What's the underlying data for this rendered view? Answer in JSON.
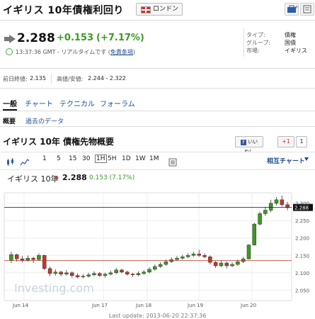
{
  "header": {
    "title": "イギリス 10年債権利回り",
    "region_button": "ロンドン"
  },
  "quote": {
    "price": "2.288",
    "change": "+0.153",
    "change_pct": "(+7.17%)",
    "time": "13:37:36 GMT - リアルタイムです",
    "disclaimer": "免責条項"
  },
  "info": {
    "type_label": "タイプ:",
    "type_value": "債権",
    "group_label": "グループ:",
    "group_value": "国債",
    "market_label": "市場:",
    "market_value": "イギリス"
  },
  "stats": {
    "prev_close_label": "前日終値:",
    "prev_close": "2.135",
    "range_label": "高値/安値:",
    "range": "2.244 - 2.322"
  },
  "tabs": [
    "一般",
    "チャート",
    "テクニカル",
    "フォーラム"
  ],
  "subtabs": [
    "概要",
    "過去のデータ"
  ],
  "section_title": "イギリス 10年 債権先物概要",
  "social": {
    "like": "いいね！",
    "gplus": "+1",
    "gcount": "1"
  },
  "timeframes": [
    "1",
    "5",
    "15",
    "30",
    "1H",
    "5H",
    "1D",
    "1W",
    "1M"
  ],
  "selected_timeframe": "1H",
  "related_chart": "相互チャート",
  "chart_header": {
    "name": "イギリス 10年",
    "price": "2.288",
    "change": "0.153 (7.17%)"
  },
  "footer": "Last update: 2013-06-20 22:37:36",
  "watermark": "Investing.com",
  "chart_data": {
    "type": "candlestick",
    "x_labels": [
      "Jun 14",
      "Jun 17",
      "Jun 18",
      "Jun 19",
      "Jun 20"
    ],
    "y_ticks": [
      "2.300",
      "2.250",
      "2.200",
      "2.150",
      "2.100",
      "2.050"
    ],
    "ylim": [
      2.02,
      2.33
    ],
    "current_price_label": "2.288",
    "current_price": 2.288,
    "prev_close": 2.135,
    "candles": [
      [
        2.135,
        2.152,
        2.16,
        2.128
      ],
      [
        2.152,
        2.14,
        2.155,
        2.132
      ],
      [
        2.14,
        2.136,
        2.148,
        2.13
      ],
      [
        2.136,
        2.142,
        2.15,
        2.132
      ],
      [
        2.142,
        2.138,
        2.146,
        2.128
      ],
      [
        2.138,
        2.15,
        2.156,
        2.134
      ],
      [
        2.15,
        2.112,
        2.152,
        2.108
      ],
      [
        2.112,
        2.098,
        2.118,
        2.09
      ],
      [
        2.098,
        2.102,
        2.11,
        2.092
      ],
      [
        2.102,
        2.096,
        2.106,
        2.09
      ],
      [
        2.096,
        2.1,
        2.108,
        2.092
      ],
      [
        2.1,
        2.092,
        2.104,
        2.086
      ],
      [
        2.092,
        2.088,
        2.098,
        2.084
      ],
      [
        2.088,
        2.09,
        2.096,
        2.084
      ],
      [
        2.09,
        2.094,
        2.1,
        2.086
      ],
      [
        2.094,
        2.098,
        2.104,
        2.09
      ],
      [
        2.098,
        2.092,
        2.102,
        2.088
      ],
      [
        2.092,
        2.096,
        2.1,
        2.086
      ],
      [
        2.096,
        2.1,
        2.106,
        2.092
      ],
      [
        2.1,
        2.108,
        2.114,
        2.096
      ],
      [
        2.108,
        2.102,
        2.112,
        2.098
      ],
      [
        2.102,
        2.096,
        2.106,
        2.092
      ],
      [
        2.096,
        2.094,
        2.1,
        2.088
      ],
      [
        2.094,
        2.098,
        2.104,
        2.09
      ],
      [
        2.098,
        2.102,
        2.108,
        2.094
      ],
      [
        2.102,
        2.11,
        2.116,
        2.098
      ],
      [
        2.11,
        2.118,
        2.124,
        2.106
      ],
      [
        2.118,
        2.124,
        2.13,
        2.114
      ],
      [
        2.124,
        2.132,
        2.138,
        2.12
      ],
      [
        2.132,
        2.138,
        2.144,
        2.128
      ],
      [
        2.138,
        2.142,
        2.148,
        2.134
      ],
      [
        2.142,
        2.146,
        2.152,
        2.138
      ],
      [
        2.146,
        2.15,
        2.156,
        2.142
      ],
      [
        2.15,
        2.154,
        2.16,
        2.146
      ],
      [
        2.154,
        2.15,
        2.166,
        2.146
      ],
      [
        2.15,
        2.146,
        2.156,
        2.142
      ],
      [
        2.146,
        2.13,
        2.15,
        2.124
      ],
      [
        2.13,
        2.12,
        2.134,
        2.114
      ],
      [
        2.12,
        2.128,
        2.134,
        2.116
      ],
      [
        2.128,
        2.12,
        2.132,
        2.112
      ],
      [
        2.12,
        2.124,
        2.13,
        2.116
      ],
      [
        2.124,
        2.132,
        2.138,
        2.12
      ],
      [
        2.132,
        2.14,
        2.146,
        2.128
      ],
      [
        2.14,
        2.18,
        2.182,
        2.138
      ],
      [
        2.18,
        2.24,
        2.244,
        2.178
      ],
      [
        2.24,
        2.27,
        2.276,
        2.236
      ],
      [
        2.27,
        2.28,
        2.29,
        2.264
      ],
      [
        2.28,
        2.3,
        2.31,
        2.274
      ],
      [
        2.3,
        2.31,
        2.318,
        2.294
      ],
      [
        2.31,
        2.296,
        2.322,
        2.29
      ],
      [
        2.296,
        2.288,
        2.304,
        2.28
      ]
    ]
  }
}
